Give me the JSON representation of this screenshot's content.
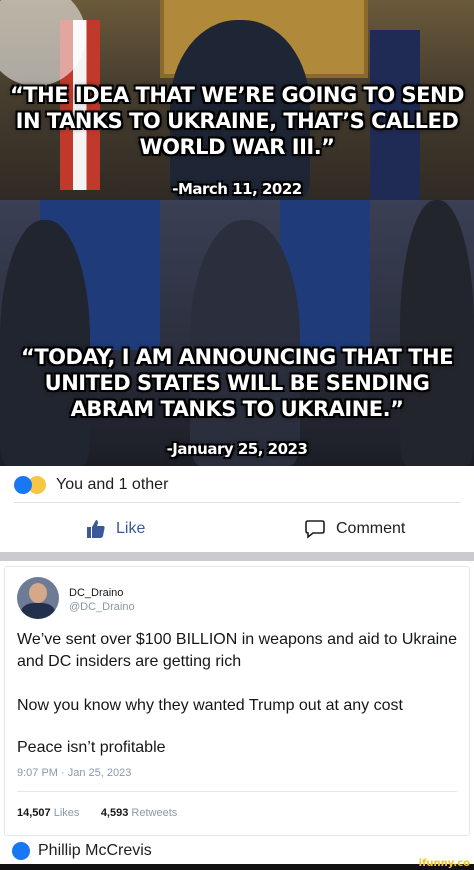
{
  "meme": {
    "quote_1": "“THE IDEA THAT WE’RE GOING TO SEND IN TANKS TO UKRAINE, THAT’S CALLED WORLD WAR III.”",
    "date_1": "-March 11, 2022",
    "quote_2": "“TODAY, I AM ANNOUNCING THAT THE UNITED STATES WILL BE SENDING ABRAM TANKS TO UKRAINE.”",
    "date_2": "-January 25, 2023"
  },
  "facebook": {
    "reactions_text": "You and 1 other",
    "like_label": "Like",
    "comment_label": "Comment",
    "poster_name": "Phillip McCrevis",
    "colors": {
      "like_blue": "#1877f2",
      "haha_yellow": "#f7c744"
    }
  },
  "tweet": {
    "display_name": "DC_Draino",
    "handle": "@DC_Draino",
    "paragraph_1": "We’ve sent over $100 BILLION in weapons and aid to Ukraine and DC insiders are getting rich",
    "paragraph_2": "Now you know why they wanted Trump out at any cost",
    "paragraph_3": "Peace isn’t profitable",
    "timestamp": "9:07 PM · Jan 25, 2023",
    "likes_count": "14,507",
    "likes_label": "Likes",
    "retweets_count": "4,593",
    "retweets_label": "Retweets"
  },
  "watermark": "ifunny.co"
}
